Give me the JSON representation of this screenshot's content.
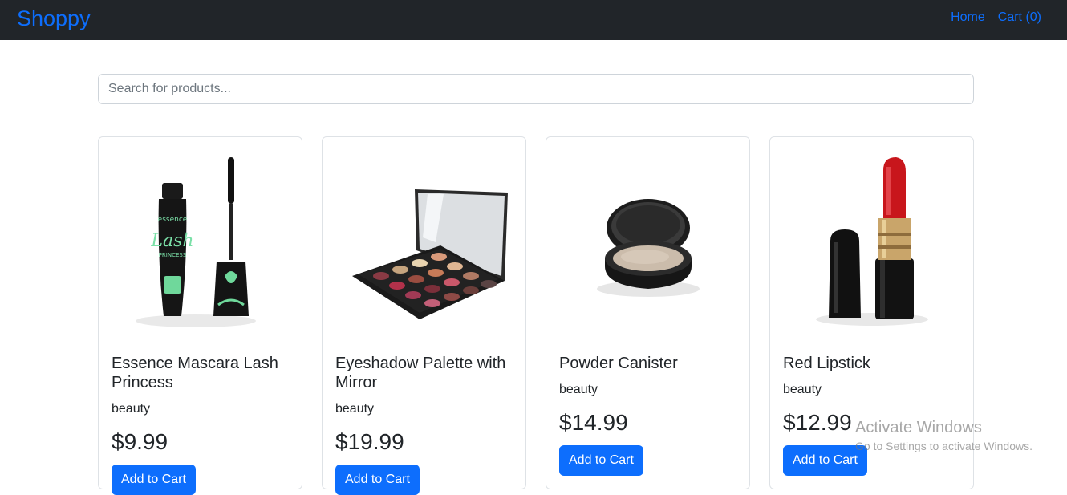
{
  "navbar": {
    "brand": "Shoppy",
    "links": [
      {
        "label": "Home"
      },
      {
        "label": "Cart (0)"
      }
    ]
  },
  "search": {
    "placeholder": "Search for products...",
    "value": ""
  },
  "products": [
    {
      "title": "Essence Mascara Lash Princess",
      "category": "beauty",
      "price": "$9.99",
      "button": "Add to Cart",
      "image": "mascara"
    },
    {
      "title": "Eyeshadow Palette with Mirror",
      "category": "beauty",
      "price": "$19.99",
      "button": "Add to Cart",
      "image": "eyeshadow-palette"
    },
    {
      "title": "Powder Canister",
      "category": "beauty",
      "price": "$14.99",
      "button": "Add to Cart",
      "image": "powder-compact"
    },
    {
      "title": "Red Lipstick",
      "category": "beauty",
      "price": "$12.99",
      "button": "Add to Cart",
      "image": "lipstick"
    }
  ],
  "watermark": {
    "title": "Activate Windows",
    "subtitle": "Go to Settings to activate Windows."
  },
  "colors": {
    "navbar_bg": "#212529",
    "accent": "#0d6efd",
    "border": "#dee2e6"
  }
}
